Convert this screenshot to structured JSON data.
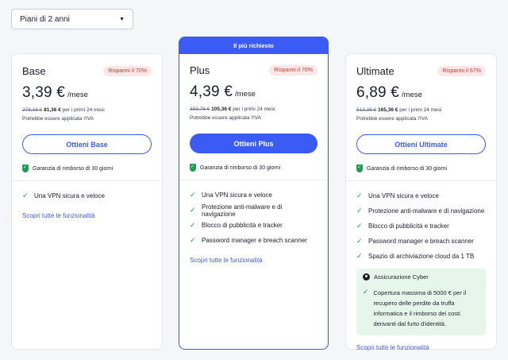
{
  "selector": {
    "value": "Piani di 2 anni"
  },
  "plans": [
    {
      "name": "Base",
      "badge": "Risparmi il 70%",
      "price": "3,39 €",
      "per": "/mese",
      "old_price": "278,16 €",
      "new_price": "81,36 €",
      "period_text": "per i primi 24 mesi",
      "vat": "Potrebbe essere applicata l'IVA",
      "cta": "Ottieni Base",
      "guarantee": "Garanzia di rimborso di 30 giorni",
      "features": [
        "Una VPN sicura e veloce"
      ],
      "link": "Scopri tutte le funzionalità"
    },
    {
      "ribbon": "Il più richiesto",
      "name": "Plus",
      "badge": "Risparmi il 70%",
      "price": "4,39 €",
      "per": "/mese",
      "old_price": "359,76 €",
      "new_price": "105,36 €",
      "period_text": "per i primi 24 mesi",
      "vat": "Potrebbe essere applicata l'IVA",
      "cta": "Ottieni Plus",
      "guarantee": "Garanzia di rimborso di 30 giorni",
      "features": [
        "Una VPN sicura e veloce",
        "Protezione anti-malware e di navigazione",
        "Blocco di pubblicità e tracker",
        "Password manager e breach scanner"
      ],
      "link": "Scopri tutte le funzionalità"
    },
    {
      "name": "Ultimate",
      "badge": "Risparmi il 67%",
      "price": "6,89 €",
      "per": "/mese",
      "old_price": "513,36 €",
      "new_price": "165,36 €",
      "period_text": "per i primi 24 mesi",
      "vat": "Potrebbe essere applicata l'IVA",
      "cta": "Ottieni Ultimate",
      "guarantee": "Garanzia di rimborso di 30 giorni",
      "features": [
        "Una VPN sicura e veloce",
        "Protezione anti-malware e di navigazione",
        "Blocco di pubblicità e tracker",
        "Password manager e breach scanner",
        "Spazio di archiviazione cloud da 1 TB"
      ],
      "cyber": {
        "title": "Assicurazione Cyber",
        "text": "Copertura massima di 5000 € per il recupero delle perdite da truffa informatica e il rimborso dei costi derivanti dal furto d'identità."
      },
      "link": "Scopri tutte le funzionalità"
    }
  ],
  "colors": {
    "accent": "#3b5bf5",
    "check": "#1f9d55",
    "badge_bg": "#fde8e7",
    "badge_text": "#c53b34",
    "cyber_bg": "#e7f6ea"
  }
}
